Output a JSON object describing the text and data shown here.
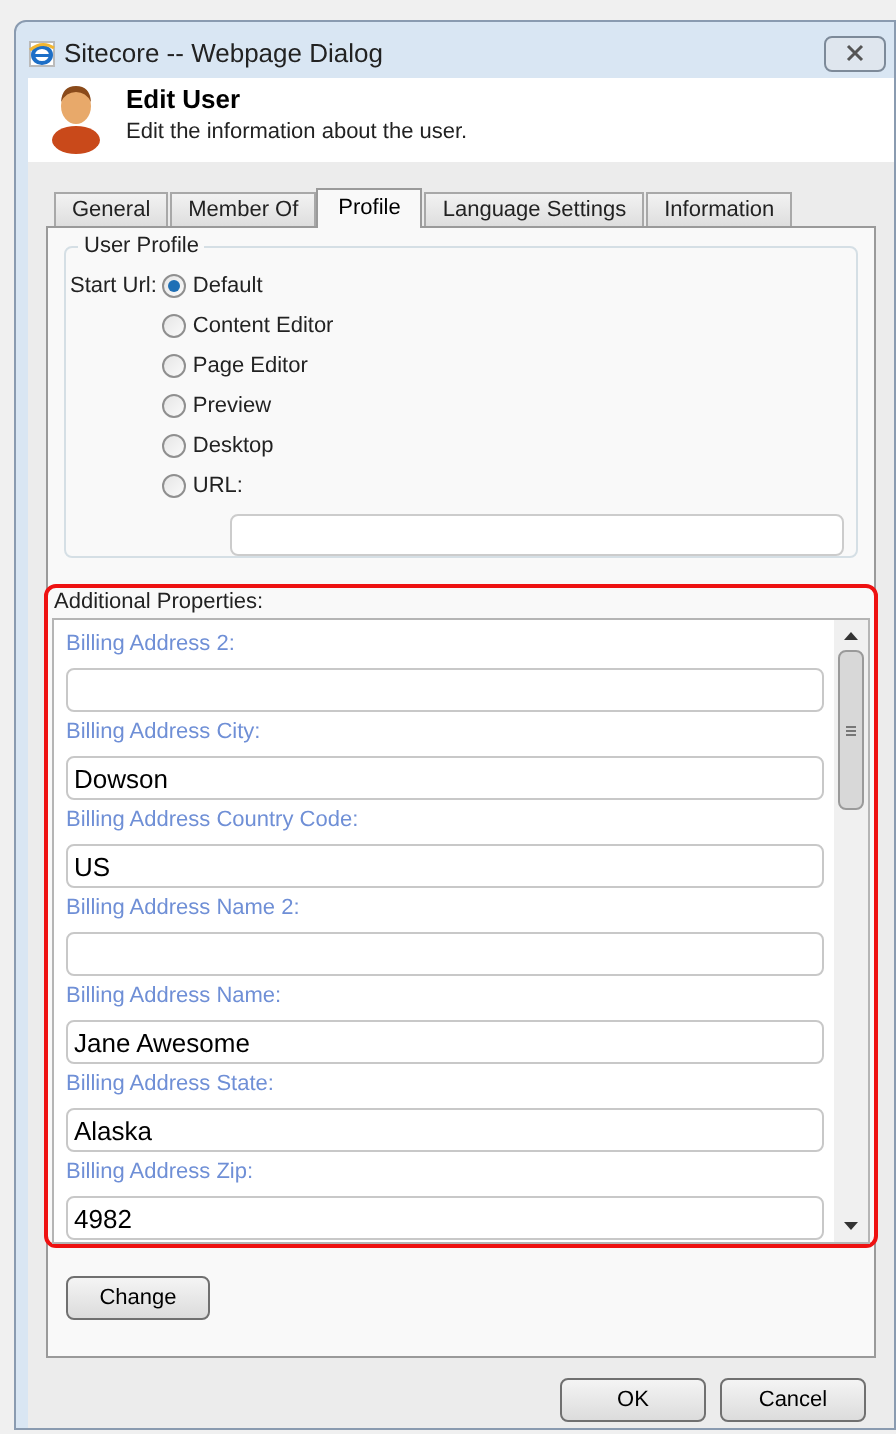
{
  "window": {
    "title": "Sitecore -- Webpage Dialog"
  },
  "header": {
    "title": "Edit User",
    "subtitle": "Edit the information about the user."
  },
  "tabs": [
    {
      "label": "General",
      "selected": false
    },
    {
      "label": "Member Of",
      "selected": false
    },
    {
      "label": "Profile",
      "selected": true
    },
    {
      "label": "Language Settings",
      "selected": false
    },
    {
      "label": "Information",
      "selected": false
    }
  ],
  "user_profile": {
    "legend": "User Profile",
    "start_url_label": "Start Url:",
    "options": [
      {
        "label": "Default",
        "selected": true
      },
      {
        "label": "Content Editor",
        "selected": false
      },
      {
        "label": "Page Editor",
        "selected": false
      },
      {
        "label": "Preview",
        "selected": false
      },
      {
        "label": "Desktop",
        "selected": false
      },
      {
        "label": "URL:",
        "selected": false
      }
    ]
  },
  "additional_properties": {
    "title": "Additional Properties:",
    "fields": [
      {
        "label": "Billing Address 2:"
      },
      {
        "label": "Billing Address City:",
        "value": "Dowson"
      },
      {
        "label": "Billing Address Country Code:",
        "value": "US"
      },
      {
        "label": "Billing Address Name 2:"
      },
      {
        "label": "Billing Address Name:",
        "value": "Jane Awesome"
      },
      {
        "label": "Billing Address State:",
        "value": "Alaska"
      },
      {
        "label": "Billing Address Zip:",
        "value": "4982"
      }
    ]
  },
  "change_button": "Change",
  "buttons": [
    "OK",
    "Cancel"
  ]
}
